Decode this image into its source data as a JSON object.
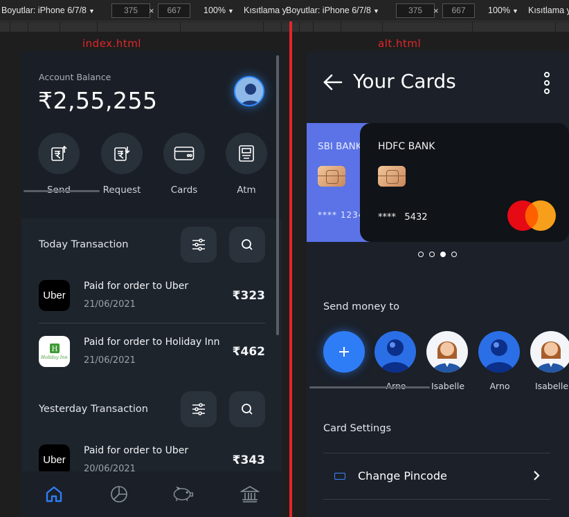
{
  "devtools": {
    "left": {
      "device": "Boyutlar: iPhone 6/7/8",
      "width": "375",
      "height": "667",
      "zoom": "100%",
      "throttle": "Kısıtlama y"
    },
    "right": {
      "device": "Boyutlar: iPhone 6/7/8",
      "width": "375",
      "height": "667",
      "zoom": "100%",
      "throttle": "Kısıtlama y"
    },
    "times": "×"
  },
  "panes": {
    "left_label": "index.html",
    "right_label": "alt.html"
  },
  "home": {
    "balance_label": "Account Balance",
    "balance_value": "₹2,55,255",
    "actions": [
      {
        "label": "Send",
        "icon": "rupee-send-icon"
      },
      {
        "label": "Request",
        "icon": "rupee-request-icon"
      },
      {
        "label": "Cards",
        "icon": "card-icon"
      },
      {
        "label": "Atm",
        "icon": "atm-icon"
      }
    ],
    "today_title": "Today Transaction",
    "yesterday_title": "Yesterday Transaction",
    "transactions_today": [
      {
        "title": "Paid for order to Uber",
        "date": "21/06/2021",
        "amount": "₹323",
        "logo": "Uber"
      },
      {
        "title": "Paid for order to Holiday Inn",
        "date": "21/06/2021",
        "amount": "₹462",
        "logo": "Holiday Inn"
      }
    ],
    "transactions_yesterday": [
      {
        "title": "Paid for order to Uber",
        "date": "20/06/2021",
        "amount": "₹343",
        "logo": "Uber"
      }
    ],
    "nav": [
      "home-icon",
      "pie-chart-icon",
      "piggy-bank-icon",
      "bank-icon"
    ]
  },
  "cards_page": {
    "title": "Your Cards",
    "cards": [
      {
        "bank": "SBI BANK",
        "number": "****  1234"
      },
      {
        "bank": "HDFC BANK",
        "number_mask": "****",
        "number_tail": "5432"
      }
    ],
    "active_dot": 2,
    "dot_count": 4,
    "send_title": "Send money to",
    "people": [
      "Arno",
      "Isabelle",
      "Arno",
      "Isabelle"
    ],
    "settings_title": "Card Settings",
    "settings": [
      {
        "label": "Change Pincode"
      }
    ]
  },
  "colors": {
    "accent": "#2f7df6",
    "divider": "#e3262a",
    "sbi_card": "#5b73e6"
  }
}
